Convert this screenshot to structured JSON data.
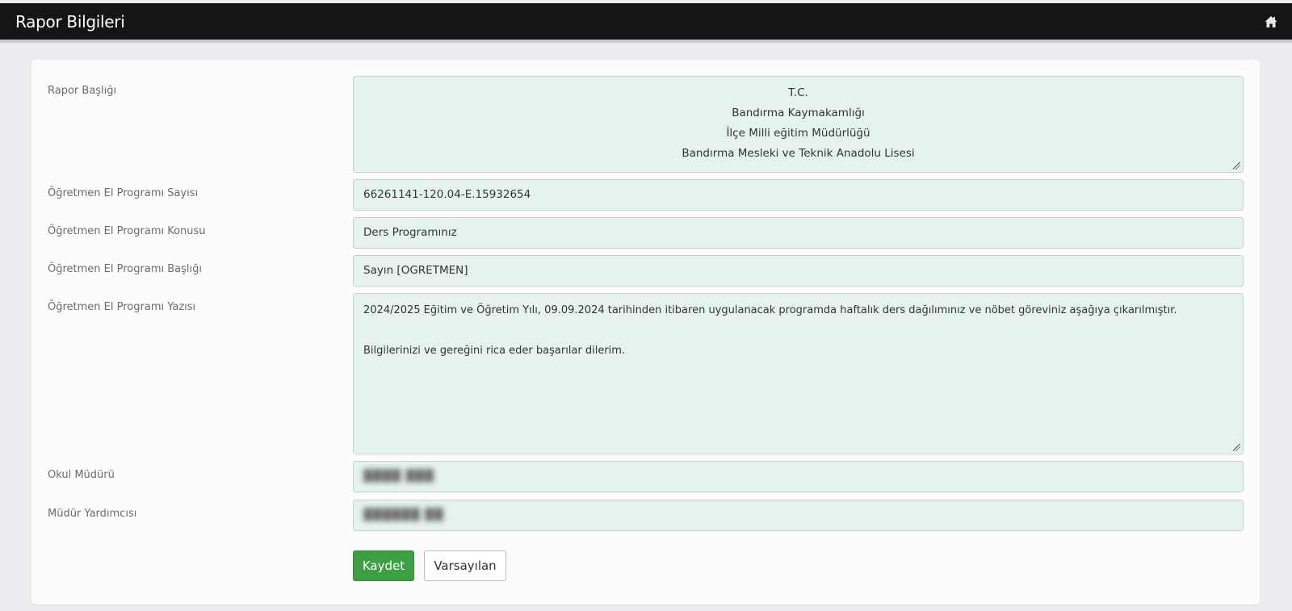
{
  "header": {
    "title": "Rapor Bilgileri",
    "home_icon": "home-icon"
  },
  "form": {
    "rapor_basligi": {
      "label": "Rapor Başlığı",
      "lines": [
        "T.C.",
        "Bandırma Kaymakamlığı",
        "İlçe Milli eğitim Müdürlüğü",
        "Bandırma Mesleki ve Teknik Anadolu Lisesi"
      ]
    },
    "sayi": {
      "label": "Öğretmen El Programı Sayısı",
      "value": "66261141-120.04-E.15932654"
    },
    "konu": {
      "label": "Öğretmen El Programı Konusu",
      "value": "Ders Programınız"
    },
    "baslik": {
      "label": "Öğretmen El Programı Başlığı",
      "value": "Sayın [OGRETMEN]"
    },
    "yazi": {
      "label": "Öğretmen El Programı Yazısı",
      "lines": [
        "2024/2025 Eğitim ve Öğretim Yılı, 09.09.2024 tarihinden itibaren uygulanacak programda haftalık ders dağılımınız ve nöbet göreviniz aşağıya çıkarılmıştır.",
        "",
        "Bilgilerinizi ve gereğini rica eder başarılar dilerim."
      ]
    },
    "okul_muduru": {
      "label": "Okul Müdürü"
    },
    "mudur_yardimcisi": {
      "label": "Müdür Yardımcısı"
    }
  },
  "buttons": {
    "save": "Kaydet",
    "default": "Varsayılan"
  },
  "colors": {
    "header_bg": "#151515",
    "field_bg": "#e6f2ef",
    "save_bg": "#3d9e44"
  }
}
